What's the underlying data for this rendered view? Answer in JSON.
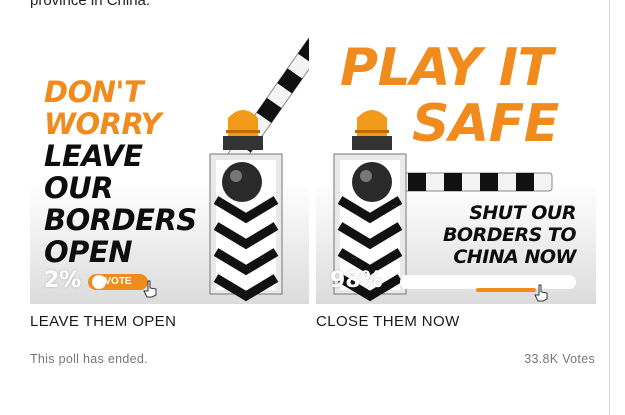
{
  "context": {
    "top_text": "province in China."
  },
  "poll": {
    "options": [
      {
        "headline_orange": [
          "DON'T",
          "WORRY"
        ],
        "headline_black": [
          "LEAVE",
          "OUR",
          "BORDERS",
          "OPEN"
        ],
        "percent_text": "2%",
        "percent_value": 2,
        "vote_button_label": "VOTE",
        "label": "LEAVE THEM OPEN"
      },
      {
        "headline_orange": [
          "PLAY IT",
          "SAFE"
        ],
        "headline_black": [
          "SHUT OUR",
          "BORDERS TO",
          "CHINA NOW"
        ],
        "percent_text": "98%",
        "percent_value": 98,
        "label": "CLOSE THEM NOW"
      }
    ],
    "status_text": "This poll has ended.",
    "votes_text": "33.8K Votes"
  },
  "colors": {
    "accent_orange": "#f08c1e",
    "black": "#0d0d0d"
  },
  "icons": [
    "barrier-gate-icon",
    "warning-beacon-icon",
    "cursor-hand-icon"
  ]
}
